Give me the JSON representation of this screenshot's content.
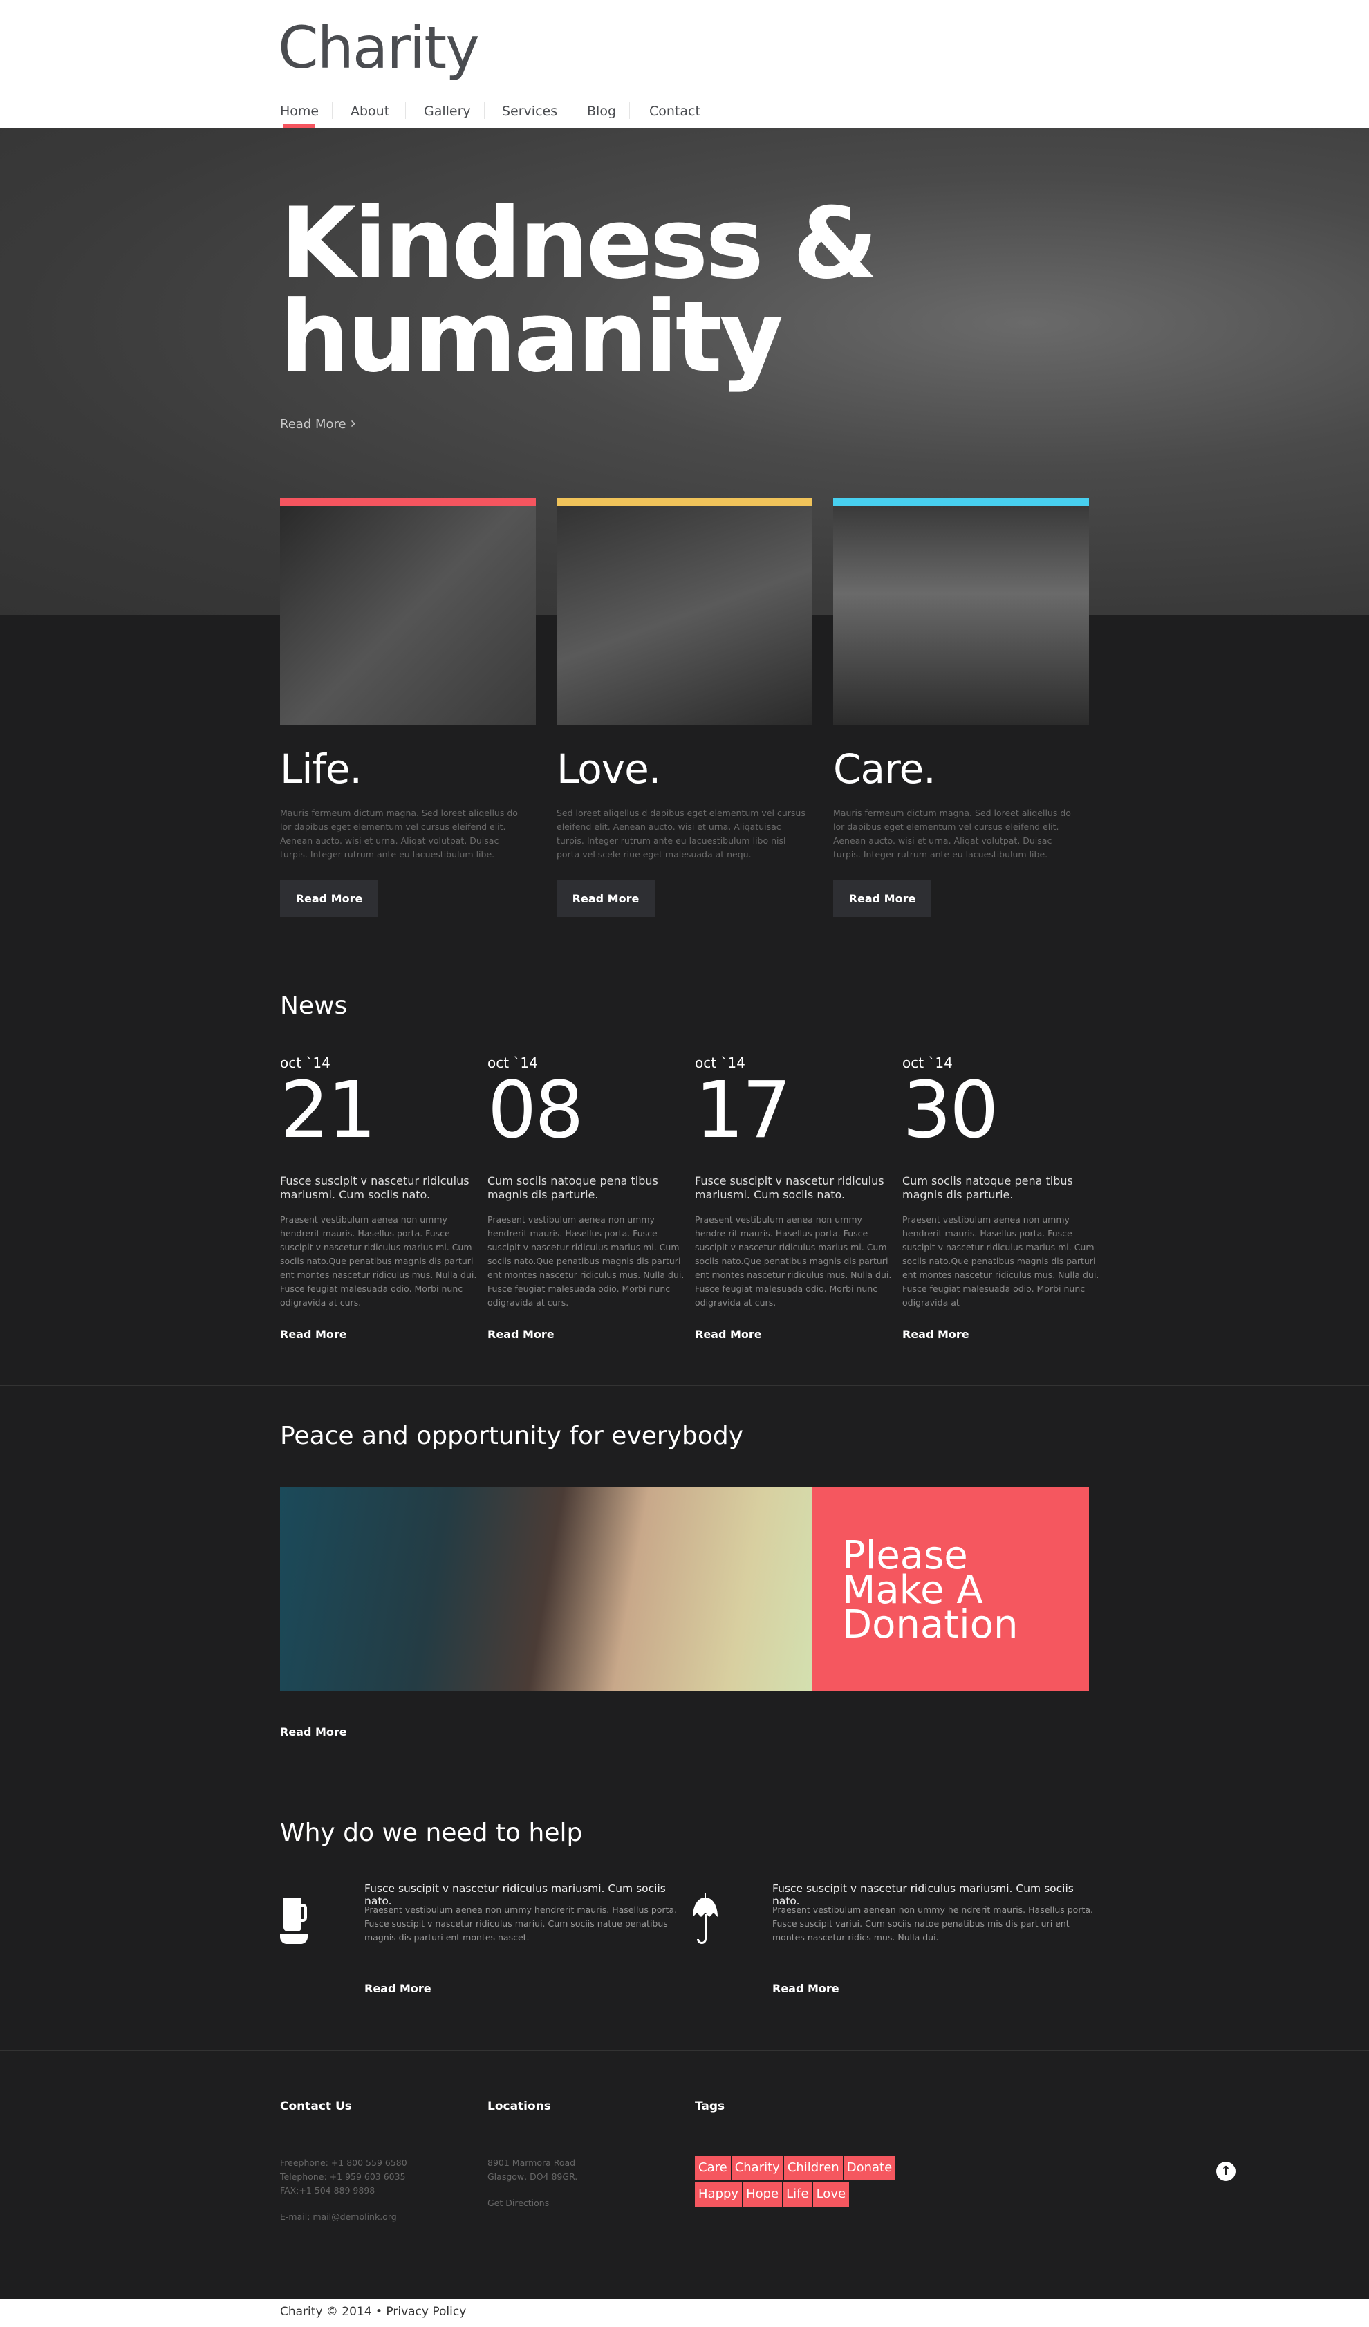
{
  "header": {
    "logo": "Charity",
    "nav": [
      "Home",
      "About",
      "Gallery",
      "Services",
      "Blog",
      "Contact"
    ],
    "active": "Home"
  },
  "hero": {
    "title_line1": "Kindness &",
    "title_line2": "humanity",
    "read_more": "Read More",
    "arrow_icon": "chevron-right-icon"
  },
  "cards": [
    {
      "title": "Life.",
      "accent": "#f5555f",
      "body": "Mauris fermeum dictum magna. Sed loreet aliqellus do lor dapibus eget elementum vel cursus eleifend elit. Aenean aucto. wisi et urna. Aliqat volutpat. Duisac turpis. Integer rutrum ante eu lacuestibulum libe.",
      "button": "Read More"
    },
    {
      "title": "Love.",
      "accent": "#f0c35a",
      "body": "Sed loreet aliqellus d dapibus eget elementum vel cursus eleifend elit. Aenean aucto. wisi et urna. Aliqatuisac turpis. Integer rutrum ante eu lacuestibulum libo nisl porta vel scele-riue eget malesuada at nequ.",
      "button": "Read More"
    },
    {
      "title": "Care.",
      "accent": "#48d0f0",
      "body": "Mauris fermeum dictum magna. Sed loreet aliqellus do lor dapibus eget elementum vel cursus eleifend elit. Aenean aucto. wisi et urna. Aliqat volutpat. Duisac turpis. Integer rutrum ante eu lacuestibulum libe.",
      "button": "Read More"
    }
  ],
  "news": {
    "title": "News",
    "items": [
      {
        "month": "oct `14",
        "day": "21",
        "headline": "Fusce suscipit v nascetur ridiculus mariusmi. Cum sociis nato.",
        "body": "Praesent vestibulum aenea non ummy hendrerit mauris. Hasellus porta. Fusce suscipit v nascetur ridiculus marius mi. Cum sociis nato.Que penatibus magnis dis parturi ent montes nascetur ridiculus mus. Nulla dui. Fusce feugiat malesuada odio. Morbi nunc odigravida at curs.",
        "more": "Read More"
      },
      {
        "month": "oct `14",
        "day": "08",
        "headline": "Cum sociis natoque pena tibus magnis dis parturie.",
        "body": "Praesent vestibulum aenea non ummy hendrerit mauris. Hasellus porta. Fusce suscipit v nascetur ridiculus marius mi. Cum sociis nato.Que penatibus magnis dis parturi ent montes nascetur ridiculus mus. Nulla dui. Fusce feugiat malesuada odio. Morbi nunc odigravida at curs.",
        "more": "Read More"
      },
      {
        "month": "oct `14",
        "day": "17",
        "headline": "Fusce suscipit v nascetur ridiculus mariusmi. Cum sociis nato.",
        "body": "Praesent vestibulum aenea non ummy hendre-rit mauris. Hasellus porta. Fusce suscipit v nascetur ridiculus marius mi. Cum sociis nato.Que penatibus magnis dis parturi ent montes nascetur ridiculus mus. Nulla dui. Fusce feugiat malesuada odio. Morbi nunc odigravida at curs.",
        "more": "Read More"
      },
      {
        "month": "oct `14",
        "day": "30",
        "headline": "Cum sociis natoque pena tibus magnis dis parturie.",
        "body": "Praesent vestibulum aenea non ummy hendrerit mauris. Hasellus porta. Fusce suscipit v nascetur ridiculus marius mi. Cum sociis nato.Que penatibus magnis dis parturi ent montes nascetur ridiculus mus. Nulla dui. Fusce feugiat malesuada odio. Morbi nunc odigravida at",
        "more": "Read More"
      }
    ]
  },
  "peace": {
    "title": "Peace and opportunity for everybody",
    "donate": "Please Make A Donation",
    "donate_color": "#f5575f",
    "more": "Read More"
  },
  "why": {
    "title": "Why do we need to help",
    "items": [
      {
        "icon": "coffee-cup-icon",
        "headline": "Fusce suscipit v nascetur ridiculus mariusmi. Cum sociis nato.",
        "body": "Praesent vestibulum aenea non ummy hendrerit mauris. Hasellus porta. Fusce suscipit v nascetur ridiculus mariui. Cum sociis natue penatibus magnis dis parturi ent montes nascet.",
        "more": "Read More"
      },
      {
        "icon": "umbrella-icon",
        "headline": "Fusce suscipit v nascetur ridiculus mariusmi. Cum sociis nato.",
        "body": "Praesent vestibulum aenean non ummy he ndrerit mauris. Hasellus porta. Fusce suscipit variui. Cum sociis natoe penatibus mis dis part uri ent montes nascetur ridics mus. Nulla dui.",
        "more": "Read More"
      }
    ]
  },
  "footer": {
    "contact": {
      "title": "Contact Us",
      "freephone": "Freephone:  +1 800 559 6580",
      "telephone": "Telephone:  +1 959 603 6035",
      "fax": "FAX:+1 504 889 9898",
      "email": "E-mail: mail@demolink.org"
    },
    "locations": {
      "title": "Locations",
      "address1": "8901 Marmora Road",
      "address2": "Glasgow, DO4 89GR.",
      "directions": "Get Directions"
    },
    "tags": {
      "title": "Tags",
      "items": [
        "Care",
        "Charity",
        "Children",
        "Donate",
        "Happy",
        "Hope",
        "Life",
        "Love"
      ]
    },
    "up_icon": "arrow-up-circle-icon",
    "copyright": "Charity © 2014 • Privacy Policy"
  }
}
